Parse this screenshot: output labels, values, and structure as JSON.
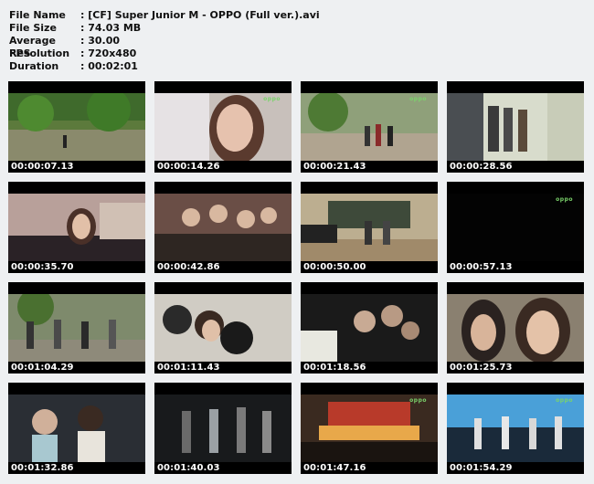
{
  "file_info": [
    {
      "key": "File Name",
      "value": ": [CF] Super Junior M - OPPO (Full ver.).avi"
    },
    {
      "key": "File Size",
      "value": ": 74.03 MB"
    },
    {
      "key": "Average FPS",
      "value": ": 30.00"
    },
    {
      "key": "Resolution",
      "value": ": 720x480"
    },
    {
      "key": "Duration",
      "value": ": 00:02:01"
    }
  ],
  "thumbnails": [
    {
      "timecode": "00:00:07.13",
      "scene": "park"
    },
    {
      "timecode": "00:00:14.26",
      "scene": "girl-close"
    },
    {
      "timecode": "00:00:21.43",
      "scene": "street"
    },
    {
      "timecode": "00:00:28.56",
      "scene": "hallway"
    },
    {
      "timecode": "00:00:35.70",
      "scene": "piano-girl"
    },
    {
      "timecode": "00:00:42.86",
      "scene": "group-piano"
    },
    {
      "timecode": "00:00:50.00",
      "scene": "classroom"
    },
    {
      "timecode": "00:00:57.13",
      "scene": "black"
    },
    {
      "timecode": "00:01:04.29",
      "scene": "outdoor-group"
    },
    {
      "timecode": "00:01:11.43",
      "scene": "group-laugh"
    },
    {
      "timecode": "00:01:18.56",
      "scene": "dark-group"
    },
    {
      "timecode": "00:01:25.73",
      "scene": "smile-close"
    },
    {
      "timecode": "00:01:32.86",
      "scene": "couple"
    },
    {
      "timecode": "00:01:40.03",
      "scene": "stage-dark"
    },
    {
      "timecode": "00:01:47.16",
      "scene": "concert"
    },
    {
      "timecode": "00:01:54.29",
      "scene": "stage-blue"
    }
  ],
  "watermark": "oppo"
}
